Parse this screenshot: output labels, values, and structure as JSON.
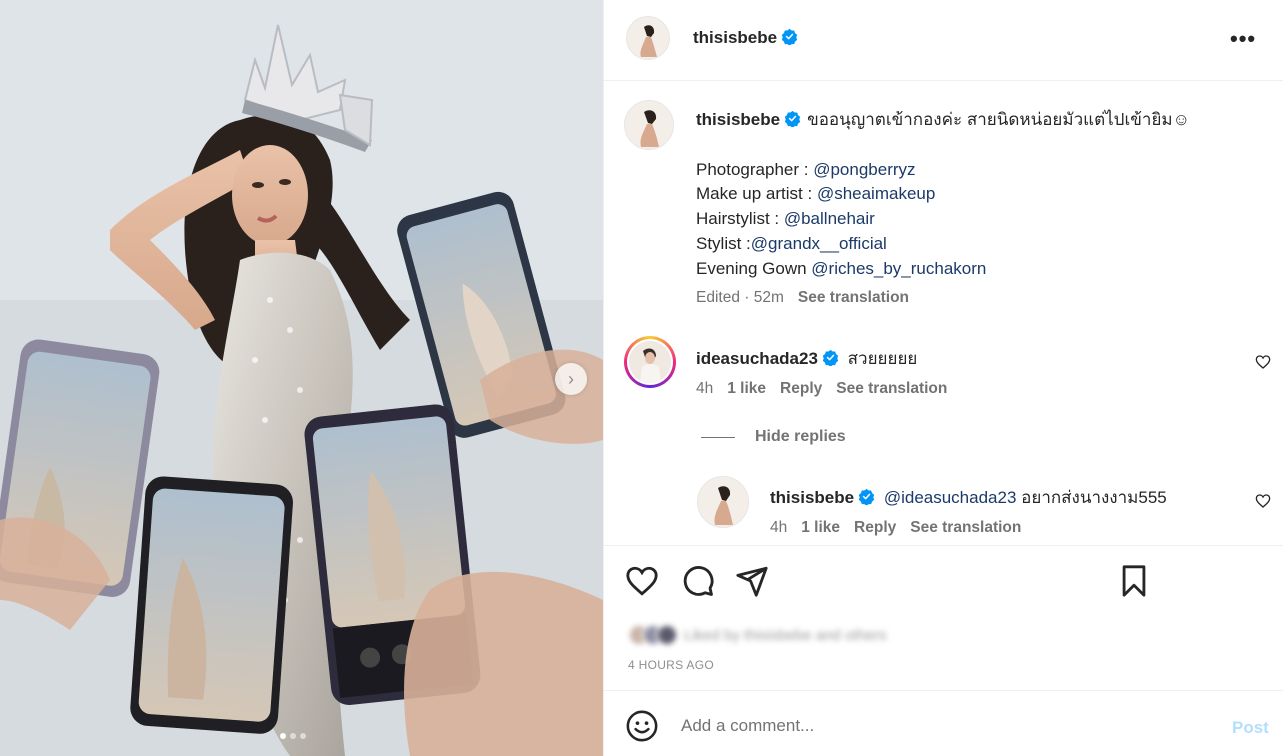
{
  "post": {
    "username": "thisisbebe",
    "more_label": "•••",
    "caption_text": "ขออนุญาตเข้ากองค่ะ สายนิดหน่อยมัวแต่ไปเข้ายิม☺",
    "credits": [
      {
        "label": "Photographer : ",
        "handle": "@pongberryz"
      },
      {
        "label": "Make up artist : ",
        "handle": "@sheaimakeup"
      },
      {
        "label": "Hairstylist : ",
        "handle": "@ballnehair"
      },
      {
        "label": "Stylist :",
        "handle": "@grandx__official"
      },
      {
        "label": "Evening Gown ",
        "handle": "@riches_by_ruchakorn"
      }
    ],
    "edited": "Edited",
    "age": "52m",
    "see_translation": "See translation"
  },
  "comments": [
    {
      "username": "ideasuchada23",
      "text": "สวยยยยย",
      "age": "4h",
      "likes": "1 like",
      "reply": "Reply",
      "see_translation": "See translation"
    }
  ],
  "hide_replies": "Hide replies",
  "replies": [
    {
      "username": "thisisbebe",
      "mention": "@ideasuchada23",
      "text": "อยากส่งนางงาม555",
      "age": "4h",
      "likes": "1 like",
      "reply": "Reply",
      "see_translation": "See translation"
    }
  ],
  "likes_text": "Liked by thisisbebe and others",
  "time_ago": "4 HOURS AGO",
  "comment_box": {
    "placeholder": "Add a comment...",
    "post_label": "Post"
  },
  "carousel": {
    "next_label": "›",
    "slide_count": 3,
    "active_slide": 1
  },
  "icons": [
    "more-icon",
    "verified-icon",
    "heart-icon",
    "comment-icon",
    "share-icon",
    "bookmark-icon",
    "emoji-icon",
    "chevron-right-icon"
  ],
  "colors": {
    "verified": "#0095f6",
    "link": "#1c3a68",
    "post_disabled": "#b2dffc"
  }
}
